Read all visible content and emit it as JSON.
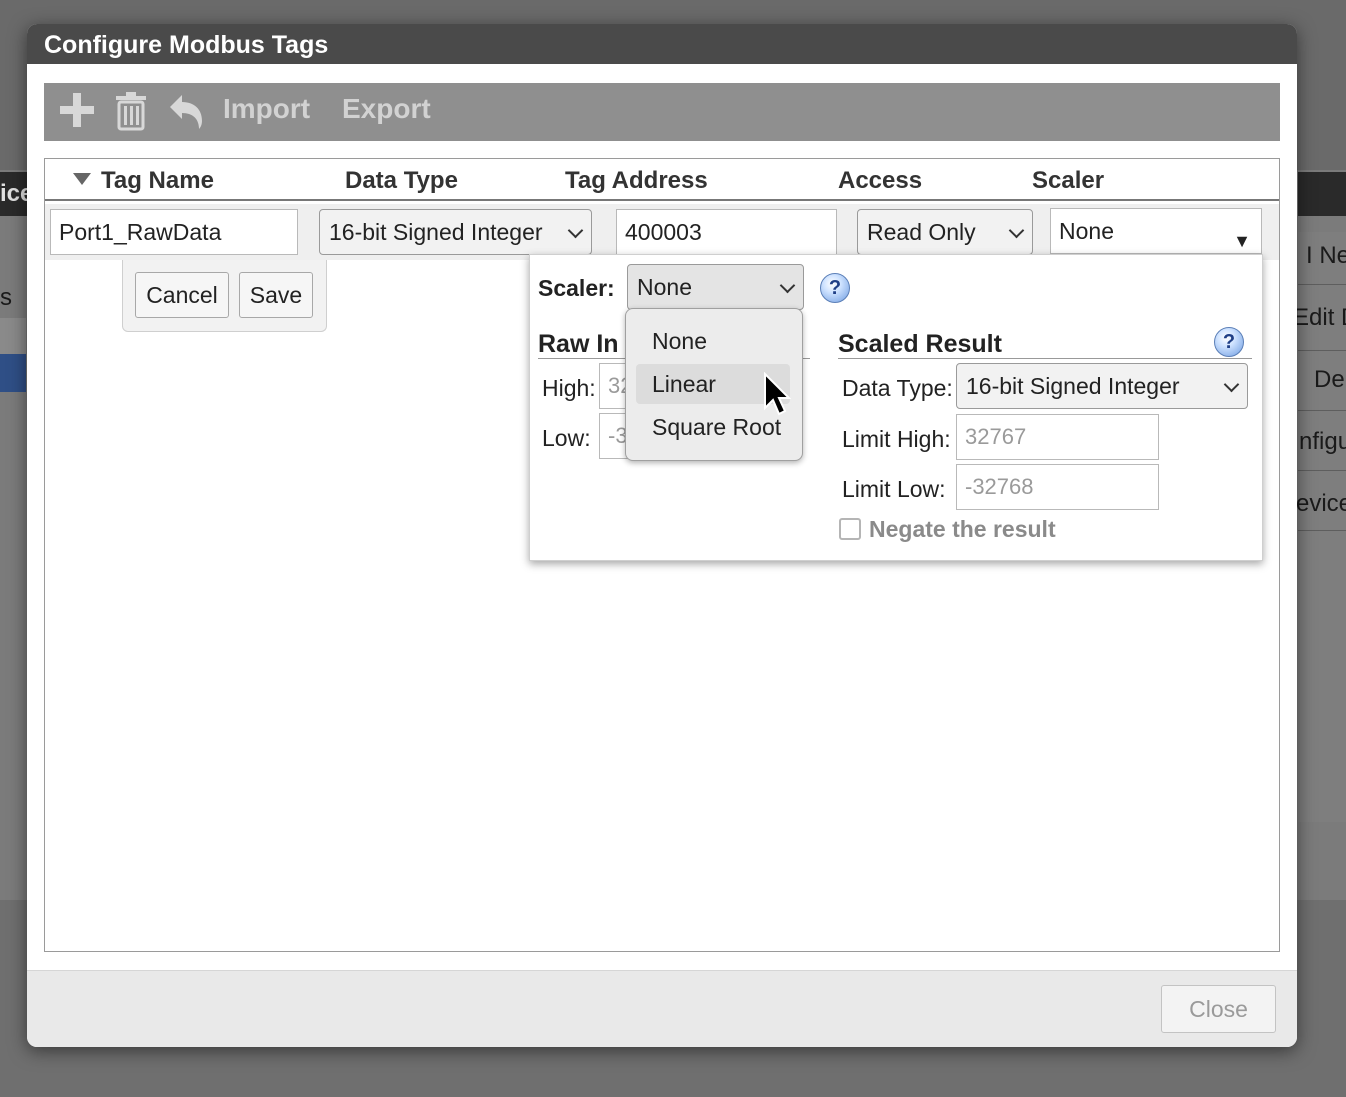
{
  "background": {
    "left_title_fragment": "ice",
    "left_row_fragment": "s",
    "right_items": [
      "I New",
      "Edit D",
      "Del",
      "nfigu",
      "evice"
    ]
  },
  "dialog": {
    "title": "Configure Modbus Tags",
    "toolbar": {
      "add_icon": "plus-icon",
      "delete_icon": "trash-icon",
      "undo_icon": "undo-icon",
      "import_label": "Import",
      "export_label": "Export"
    },
    "columns": {
      "tag_name": "Tag Name",
      "data_type": "Data Type",
      "tag_address": "Tag Address",
      "access": "Access",
      "scaler": "Scaler"
    },
    "edit_row": {
      "tag_name": "Port1_RawData",
      "data_type": "16-bit Signed Integer",
      "tag_address": "400003",
      "access": "Read Only",
      "scaler": "None"
    },
    "row_buttons": {
      "cancel": "Cancel",
      "save": "Save"
    },
    "scaler_panel": {
      "scaler_label": "Scaler:",
      "scaler_value": "None",
      "raw_input_heading": "Raw In",
      "high_label": "High:",
      "high_value": "32",
      "low_label": "Low:",
      "low_value": "-3",
      "scaled_result_heading": "Scaled Result",
      "data_type_label": "Data Type:",
      "data_type_value": "16-bit Signed Integer",
      "limit_high_label": "Limit High:",
      "limit_high_value": "32767",
      "limit_low_label": "Limit Low:",
      "limit_low_value": "-32768",
      "negate_label": "Negate the result",
      "negate_checked": false
    },
    "scaler_options": [
      "None",
      "Linear",
      "Square Root"
    ],
    "hovered_option": "Linear",
    "close_label": "Close"
  }
}
